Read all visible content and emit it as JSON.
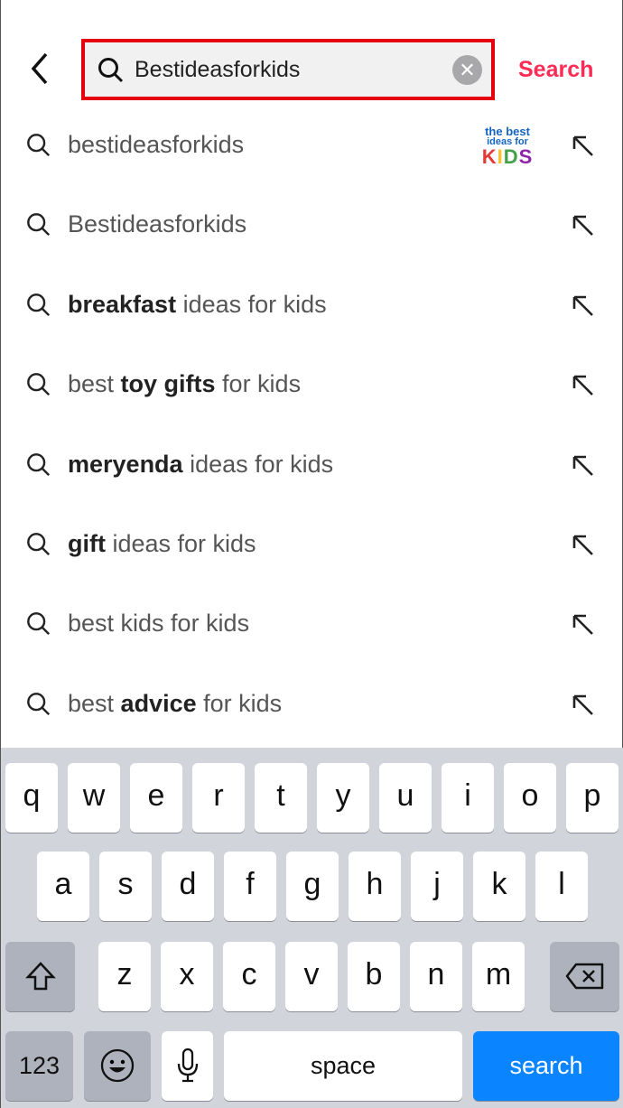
{
  "header": {
    "back_icon": "chevron-left-icon",
    "query": "Bestideasforkids",
    "clear_icon": "clear-icon",
    "search_label": "Search",
    "highlight_color": "#e5000f",
    "accent_color": "#fe2c55"
  },
  "suggestions": [
    {
      "parts": [
        {
          "t": "bestideasforkids",
          "b": false
        }
      ],
      "logo": {
        "line1": "the best",
        "line2": "ideas for",
        "line3": "KIDS"
      }
    },
    {
      "parts": [
        {
          "t": "Bestideasforkids",
          "b": false
        }
      ]
    },
    {
      "parts": [
        {
          "t": "breakfast",
          "b": true
        },
        {
          "t": " ideas for kids",
          "b": false
        }
      ]
    },
    {
      "parts": [
        {
          "t": "best ",
          "b": false
        },
        {
          "t": "toy gifts",
          "b": true
        },
        {
          "t": " for kids",
          "b": false
        }
      ]
    },
    {
      "parts": [
        {
          "t": "meryenda",
          "b": true
        },
        {
          "t": " ideas for kids",
          "b": false
        }
      ]
    },
    {
      "parts": [
        {
          "t": "gift",
          "b": true
        },
        {
          "t": " ideas for kids",
          "b": false
        }
      ]
    },
    {
      "parts": [
        {
          "t": "best kids for kids",
          "b": false
        }
      ]
    },
    {
      "parts": [
        {
          "t": "best ",
          "b": false
        },
        {
          "t": "advice",
          "b": true
        },
        {
          "t": " for kids",
          "b": false
        }
      ]
    }
  ],
  "keyboard": {
    "row1": [
      "q",
      "w",
      "e",
      "r",
      "t",
      "y",
      "u",
      "i",
      "o",
      "p"
    ],
    "row2": [
      "a",
      "s",
      "d",
      "f",
      "g",
      "h",
      "j",
      "k",
      "l"
    ],
    "row3": [
      "z",
      "x",
      "c",
      "v",
      "b",
      "n",
      "m"
    ],
    "numbers": "123",
    "space": "space",
    "search": "search",
    "return_color": "#0a84ff"
  }
}
